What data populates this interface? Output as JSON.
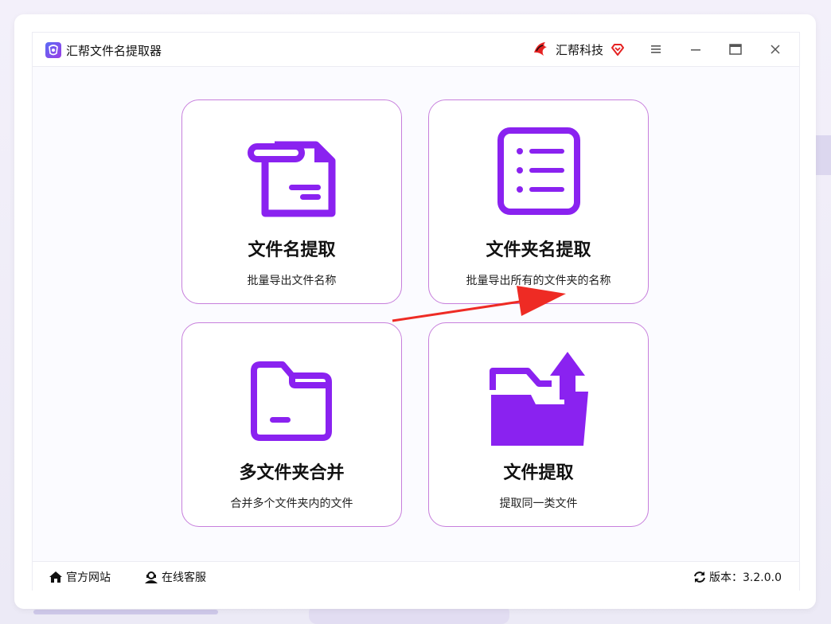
{
  "app": {
    "title": "汇帮文件名提取器"
  },
  "header": {
    "brand": "汇帮科技"
  },
  "cards": [
    {
      "title": "文件名提取",
      "subtitle": "批量导出文件名称"
    },
    {
      "title": "文件夹名提取",
      "subtitle": "批量导出所有的文件夹的名称"
    },
    {
      "title": "多文件夹合并",
      "subtitle": "合并多个文件夹内的文件"
    },
    {
      "title": "文件提取",
      "subtitle": "提取同一类文件"
    }
  ],
  "footer": {
    "website": "官方网站",
    "support": "在线客服",
    "version": "版本：3.2.0.0"
  },
  "colors": {
    "accent": "#8a22f0",
    "card_border": "#c77fdc",
    "arrow": "#ee2b24"
  }
}
